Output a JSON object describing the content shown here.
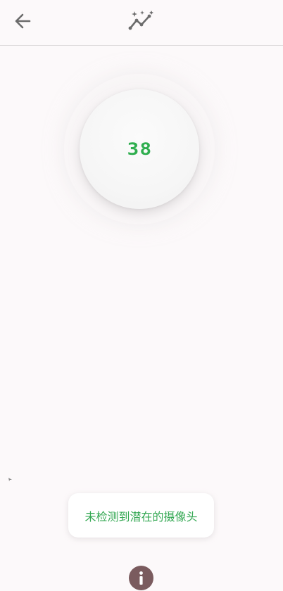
{
  "header": {
    "back_icon": "arrow-left-icon",
    "action_icon": "auto-graph-sparkle-icon"
  },
  "score": {
    "value": "38",
    "color": "#2fae4f"
  },
  "toast": {
    "message": "未检测到潜在的摄像头",
    "color": "#34a853"
  },
  "info": {
    "icon": "info-icon",
    "color": "#7a5b5e"
  },
  "colors": {
    "background": "#fcf9fa",
    "divider": "#dcd8d9",
    "icon": "#6b6b6b"
  }
}
